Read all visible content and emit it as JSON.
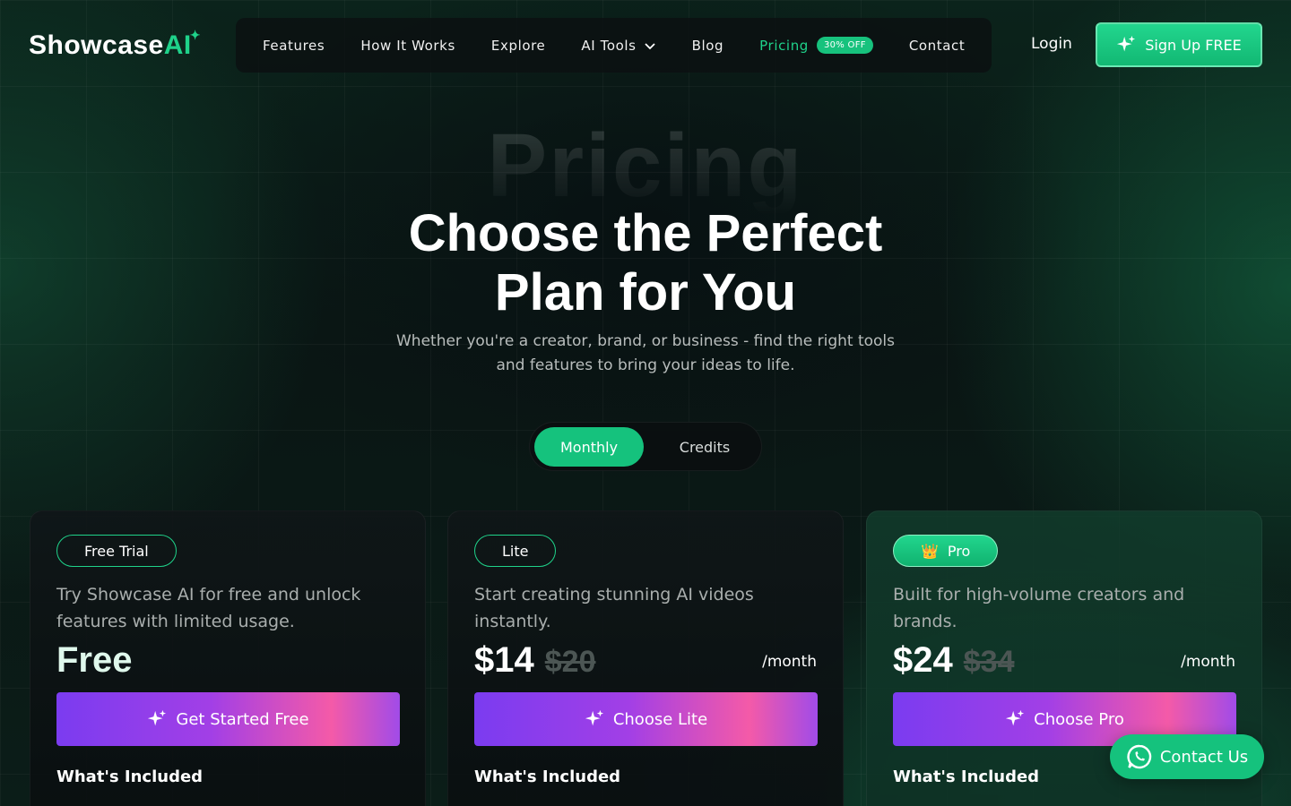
{
  "brand": {
    "name_prefix": "Sh",
    "name_o": "o",
    "name_mid": "wcase",
    "name_ai": "AI",
    "spark": "✦"
  },
  "nav": {
    "items": [
      {
        "label": "Features"
      },
      {
        "label": "How It Works"
      },
      {
        "label": "Explore"
      },
      {
        "label": "AI Tools",
        "chevron": "⌄"
      },
      {
        "label": "Blog"
      },
      {
        "label": "Pricing",
        "badge": "30% OFF",
        "active": true
      },
      {
        "label": "Contact"
      }
    ]
  },
  "header": {
    "login": "Login",
    "signup": "Sign Up FREE"
  },
  "hero": {
    "ghost": "Pricing",
    "title_line1": "Choose the Perfect",
    "title_line2": "Plan for You",
    "subtitle_line1": "Whether you're a creator, brand, or business - find the right tools",
    "subtitle_line2": "and features to bring your ideas to life."
  },
  "toggle": {
    "monthly": "Monthly",
    "credits": "Credits",
    "selected": "Monthly"
  },
  "plans": [
    {
      "tag": "Free Trial",
      "description": "Try Showcase AI for free and unlock features with limited usage.",
      "price": "Free",
      "old_price": "",
      "period": "",
      "cta": "Get Started Free",
      "included": "What's Included"
    },
    {
      "tag": "Lite",
      "description": "Start creating stunning AI videos instantly.",
      "price": "$14",
      "old_price": "$20",
      "period": "/month",
      "cta": "Choose Lite",
      "included": "What's Included"
    },
    {
      "tag": "Pro",
      "tag_icon": "👑",
      "description": "Built for high-volume creators and brands.",
      "price": "$24",
      "old_price": "$34",
      "period": "/month",
      "cta": "Choose Pro",
      "included": "What's Included"
    }
  ],
  "floating": {
    "contact": "Contact Us"
  },
  "colors": {
    "accent": "#15c27d",
    "cta_start": "#7b3cf0",
    "cta_end": "#f45aa8"
  }
}
